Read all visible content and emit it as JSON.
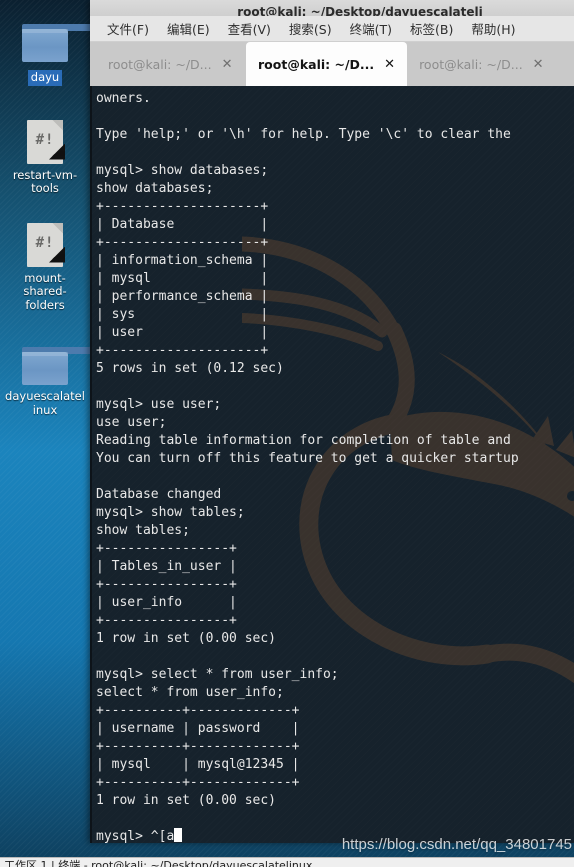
{
  "window": {
    "title": "root@kali: ~/Desktop/dayuescalateli"
  },
  "menu": {
    "items": [
      {
        "label": "文件(F)",
        "name": "menu-file"
      },
      {
        "label": "编辑(E)",
        "name": "menu-edit"
      },
      {
        "label": "查看(V)",
        "name": "menu-view"
      },
      {
        "label": "搜索(S)",
        "name": "menu-search"
      },
      {
        "label": "终端(T)",
        "name": "menu-terminal"
      },
      {
        "label": "标签(B)",
        "name": "menu-tabs"
      },
      {
        "label": "帮助(H)",
        "name": "menu-help"
      }
    ]
  },
  "tabs": [
    {
      "label": "root@kali: ~/D...",
      "close": "✕",
      "active": false
    },
    {
      "label": "root@kali: ~/D...",
      "close": "✕",
      "active": true
    },
    {
      "label": "root@kali: ~/D...",
      "close": "✕",
      "active": false
    }
  ],
  "desktop": {
    "icons": [
      {
        "label": "dayu",
        "type": "folder",
        "selected": true,
        "name": "desktop-icon-dayu"
      },
      {
        "label": "restart-vm-tools",
        "type": "script",
        "selected": false,
        "name": "desktop-icon-restart-vm-tools",
        "glyph": "#!"
      },
      {
        "label": "mount-shared-folders",
        "type": "script",
        "selected": false,
        "name": "desktop-icon-mount-shared-folders",
        "glyph": "#!"
      },
      {
        "label": "dayuescalatelinux",
        "type": "folder",
        "selected": false,
        "name": "desktop-icon-dayuescalatelinux"
      }
    ]
  },
  "terminal": {
    "lines": [
      "owners.",
      "",
      "Type 'help;' or '\\h' for help. Type '\\c' to clear the",
      "",
      "mysql> show databases;",
      "show databases;",
      "+--------------------+",
      "| Database           |",
      "+--------------------+",
      "| information_schema |",
      "| mysql              |",
      "| performance_schema |",
      "| sys                |",
      "| user               |",
      "+--------------------+",
      "5 rows in set (0.12 sec)",
      "",
      "mysql> use user;",
      "use user;",
      "Reading table information for completion of table and",
      "You can turn off this feature to get a quicker startup",
      "",
      "Database changed",
      "mysql> show tables;",
      "show tables;",
      "+----------------+",
      "| Tables_in_user |",
      "+----------------+",
      "| user_info      |",
      "+----------------+",
      "1 row in set (0.00 sec)",
      "",
      "mysql> select * from user_info;",
      "select * from user_info;",
      "+----------+-------------+",
      "| username | password    |",
      "+----------+-------------+",
      "| mysql    | mysql@12345 |",
      "+----------+-------------+",
      "1 row in set (0.00 sec)",
      ""
    ],
    "prompt": "mysql> ^[a"
  },
  "watermark": {
    "text": "https://blog.csdn.net/qq_34801745"
  },
  "taskbar": {
    "text": "工作区 1  |  终端 - root@kali: ~/Desktop/dayuescalatelinux"
  },
  "colors": {
    "terminal_bg": "#16222c",
    "desktop_accent": "#1b84bd",
    "selection": "#2a6cb8",
    "dragon": "#3a332e"
  }
}
